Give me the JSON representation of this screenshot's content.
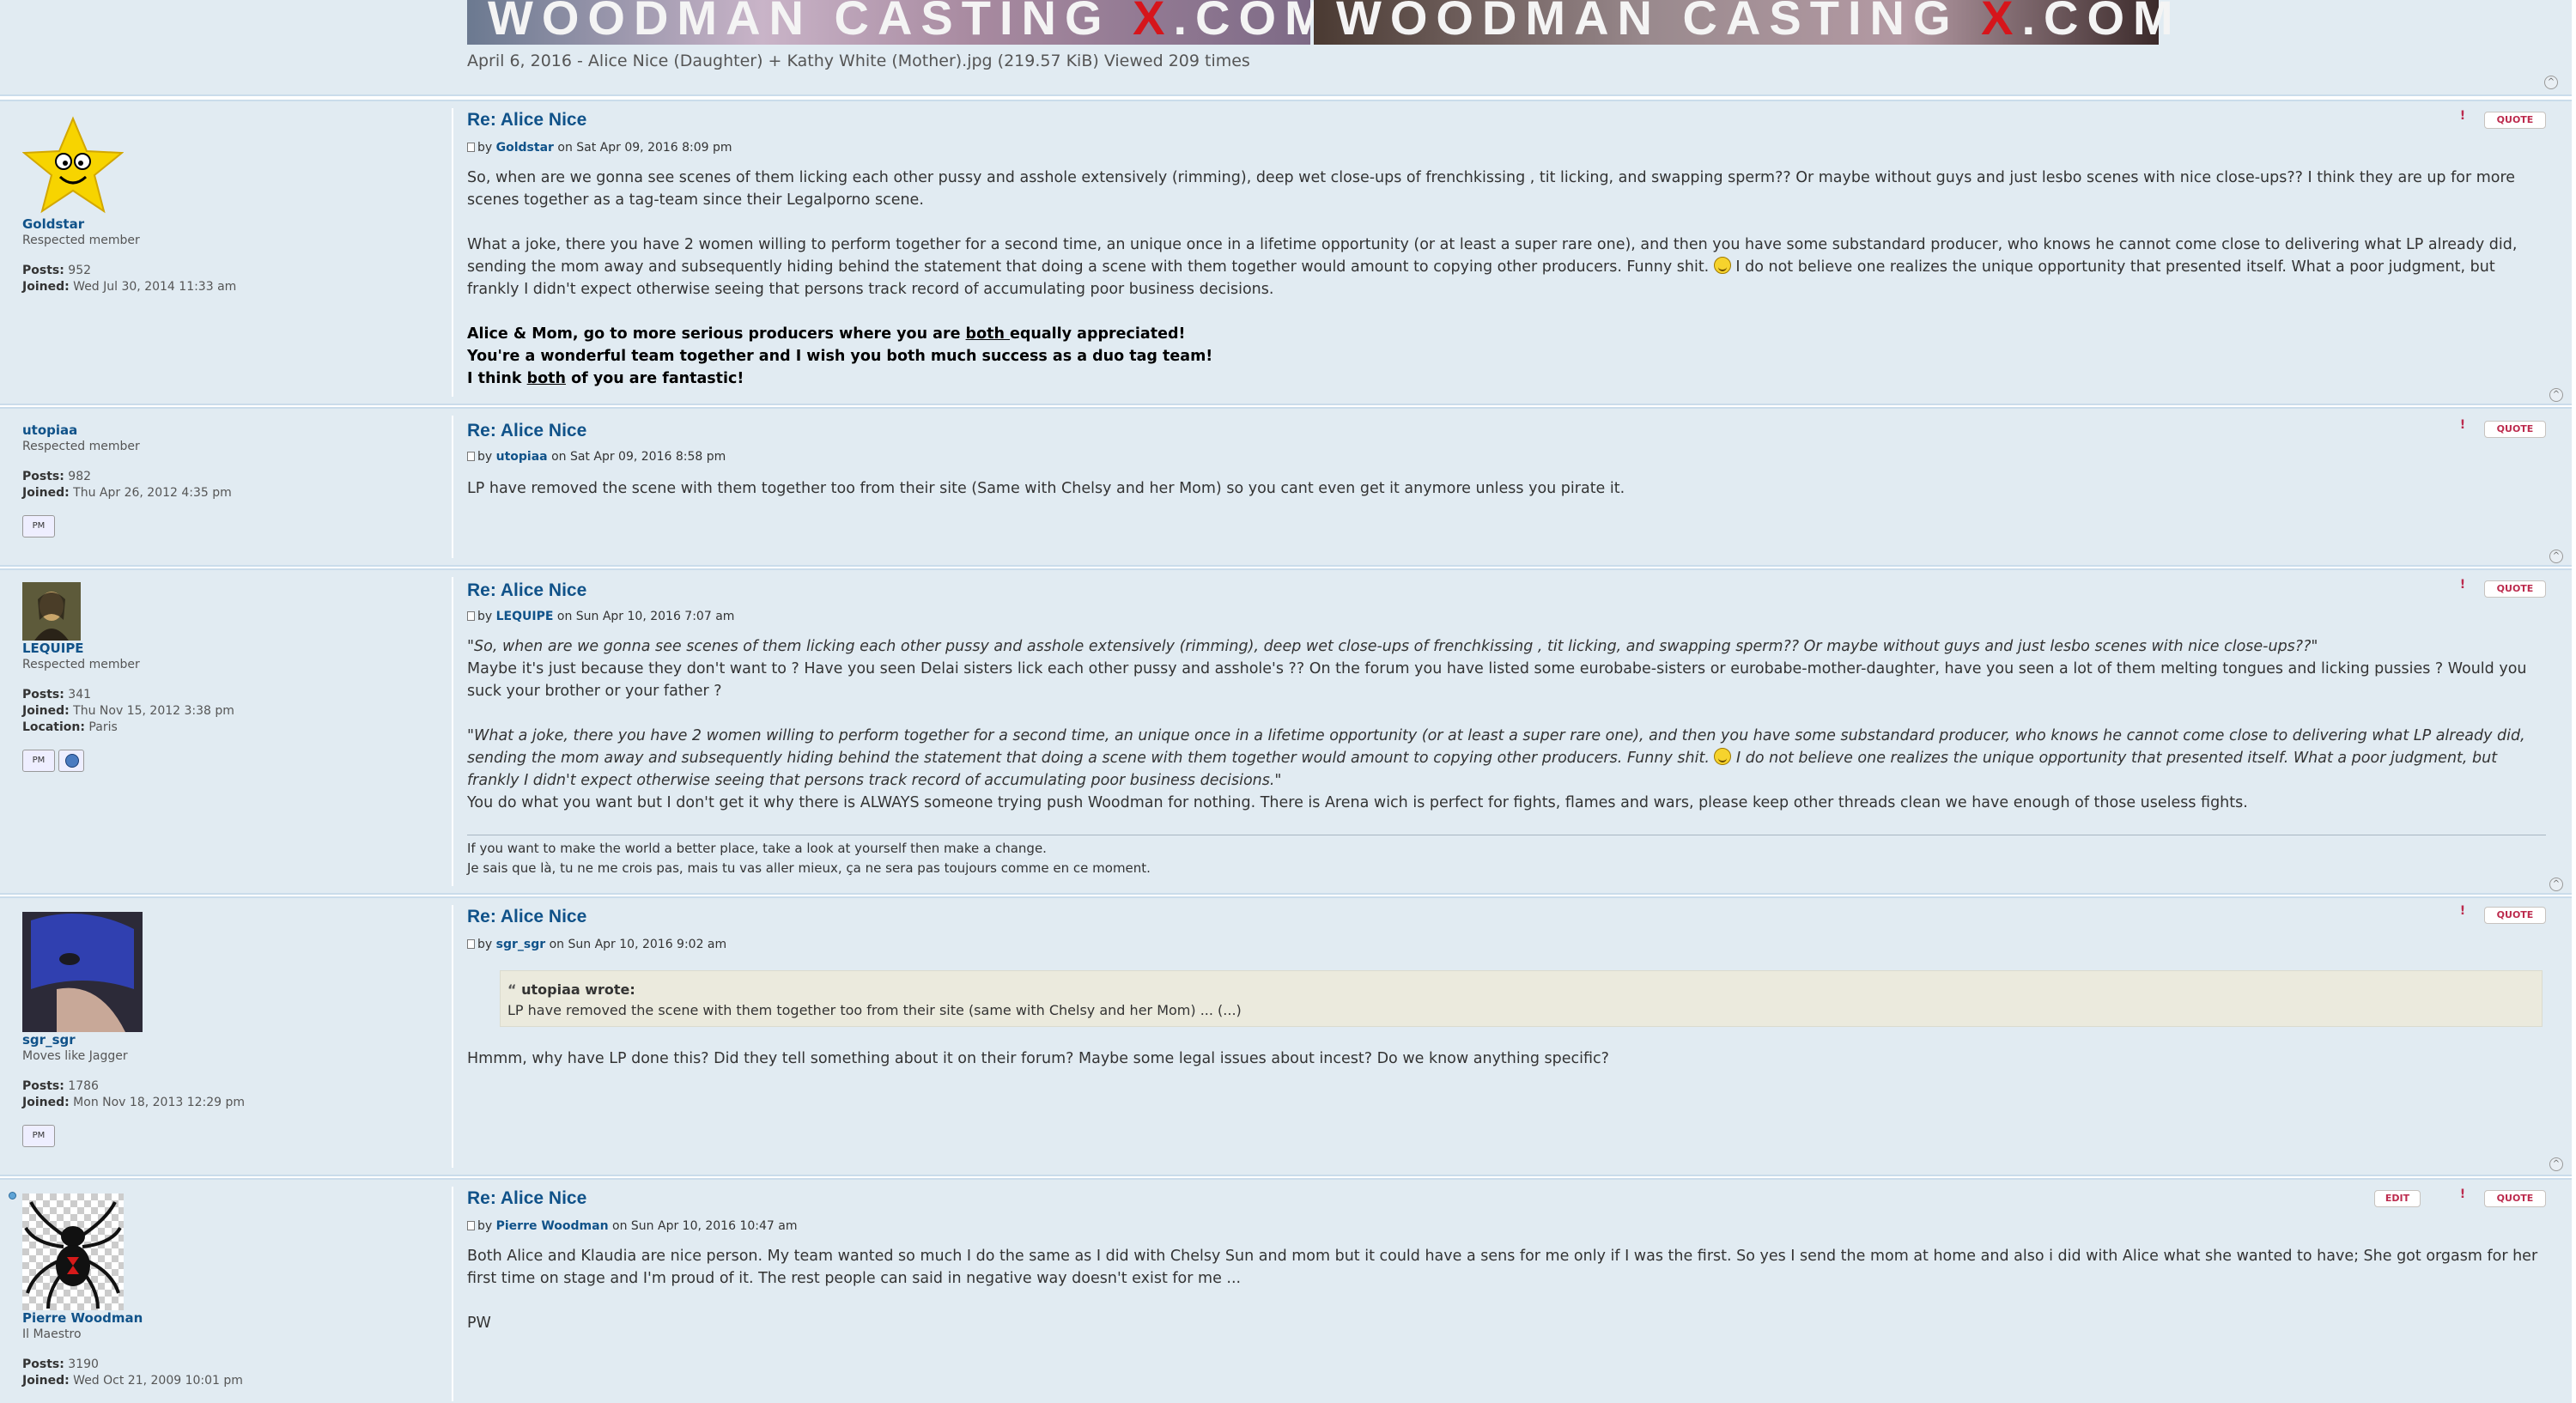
{
  "attachment": {
    "banner_left": "WOODMAN CASTING",
    "banner_left_x": "X",
    "banner_left_com": ".COM",
    "banner_right": "WOODMAN CASTING",
    "banner_right_x": "X",
    "banner_right_com": ".COM",
    "caption": "April 6, 2016 - Alice Nice (Daughter) + Kathy White (Mother).jpg (219.57 KiB) Viewed 209 times"
  },
  "buttons": {
    "quote": "QUOTE",
    "edit": "EDIT",
    "report": "!",
    "top": "^",
    "pm": "PM"
  },
  "posts": [
    {
      "title": "Re: Alice Nice",
      "by": "by",
      "author": "Goldstar",
      "date": "on Sat Apr 09, 2016 8:09 pm",
      "username": "Goldstar",
      "rank": "Respected member",
      "posts_label": "Posts:",
      "posts": "952",
      "joined_label": "Joined:",
      "joined": "Wed Jul 30, 2014 11:33 am",
      "p1": "So, when are we gonna see scenes of them licking each other pussy and asshole extensively (rimming), deep wet close-ups of frenchkissing , tit licking, and swapping sperm?? Or maybe without guys and just lesbo scenes with nice close-ups?? I think they are up for more scenes together as a tag-team since their Legalporno scene.",
      "p2a": "What a joke, there you have 2 women willing to perform together for a second time, an unique once in a lifetime opportunity (or at least a super rare one), and then you have some substandard producer, who knows he cannot come close to delivering what LP already did, sending the mom away and subsequently hiding behind the statement that doing a scene with them together would amount to copying other producers. Funny shit.",
      "p2b": "I do not believe one realizes the unique opportunity that presented itself. What a poor judgment, but frankly I didn't expect otherwise seeing that persons track record of accumulating poor business decisions.",
      "b1a": "Alice & Mom, go to more serious producers where you are ",
      "b1u": "both ",
      "b1b": "equally appreciated!",
      "b2": "You're a wonderful team together and I wish you both much success as a duo tag team!",
      "b3a": "I think ",
      "b3u": "both",
      "b3b": " of you are fantastic!"
    },
    {
      "title": "Re: Alice Nice",
      "by": "by",
      "author": "utopiaa",
      "date": "on Sat Apr 09, 2016 8:58 pm",
      "username": "utopiaa",
      "rank": "Respected member",
      "posts_label": "Posts:",
      "posts": "982",
      "joined_label": "Joined:",
      "joined": "Thu Apr 26, 2012 4:35 pm",
      "p1": "LP have removed the scene with them together too from their site (Same with Chelsy and her Mom) so you cant even get it anymore unless you pirate it."
    },
    {
      "title": "Re: Alice Nice",
      "by": "by",
      "author": "LEQUIPE",
      "date": "on Sun Apr 10, 2016 7:07 am",
      "username": "LEQUIPE",
      "rank": "Respected member",
      "posts_label": "Posts:",
      "posts": "341",
      "joined_label": "Joined:",
      "joined": "Thu Nov 15, 2012 3:38 pm",
      "location_label": "Location:",
      "location": "Paris",
      "q1": "\"So, when are we gonna see scenes of them licking each other pussy and asshole extensively (rimming), deep wet close-ups of frenchkissing , tit licking, and swapping sperm?? Or maybe without guys and just lesbo scenes with nice close-ups??\"",
      "p1": "Maybe it's just because they don't want to ? Have you seen Delai sisters lick each other pussy and asshole's ?? On the forum you have listed some eurobabe-sisters or eurobabe-mother-daughter, have you seen a lot of them melting tongues and licking pussies ? Would you suck your brother or your father ?",
      "q2a": "\"What a joke, there you have 2 women willing to perform together for a second time, an unique once in a lifetime opportunity (or at least a super rare one), and then you have some substandard producer, who knows he cannot come close to delivering what LP already did, sending the mom away and subsequently hiding behind the statement that doing a scene with them together would amount to copying other producers. Funny shit.",
      "q2b": "I do not believe one realizes the unique opportunity that presented itself. What a poor judgment, but frankly I didn't expect otherwise seeing that persons track record of accumulating poor business decisions.\"",
      "p2": "You do what you want but I don't get it why there is ALWAYS someone trying push Woodman for nothing. There is Arena wich is perfect for fights, flames and wars, please keep other threads clean we have enough of those useless fights.",
      "sig1": "If you want to make the world a better place, take a look at yourself then make a change.",
      "sig2": "Je sais que là, tu ne me crois pas, mais tu vas aller mieux, ça ne sera pas toujours comme en ce moment."
    },
    {
      "title": "Re: Alice Nice",
      "by": "by",
      "author": "sgr_sgr",
      "date": "on Sun Apr 10, 2016 9:02 am",
      "username": "sgr_sgr",
      "rank": "Moves like Jagger",
      "posts_label": "Posts:",
      "posts": "1786",
      "joined_label": "Joined:",
      "joined": "Mon Nov 18, 2013 12:29 pm",
      "quote_cite": "utopiaa wrote:",
      "quote_text": "LP have removed the scene with them together too from their site (same with Chelsy and her Mom) ... (...)",
      "p1": "Hmmm, why have LP done this? Did they tell something about it on their forum? Maybe some legal issues about incest? Do we know anything specific?"
    },
    {
      "title": "Re: Alice Nice",
      "by": "by",
      "author": "Pierre Woodman",
      "date": "on Sun Apr 10, 2016 10:47 am",
      "username": "Pierre Woodman",
      "rank": "Il Maestro",
      "posts_label": "Posts:",
      "posts": "3190",
      "joined_label": "Joined:",
      "joined": "Wed Oct 21, 2009 10:01 pm",
      "p1": "Both Alice and Klaudia are nice person. My team wanted so much I do the same as I did with Chelsy Sun and mom but it could have a sens for me only if I was the first. So yes I send the mom at home and also i did with Alice what she wanted to have; She got orgasm for her first time on stage and I'm proud of it. The rest people can said in negative way doesn't exist for me ...",
      "p2": "PW"
    }
  ]
}
